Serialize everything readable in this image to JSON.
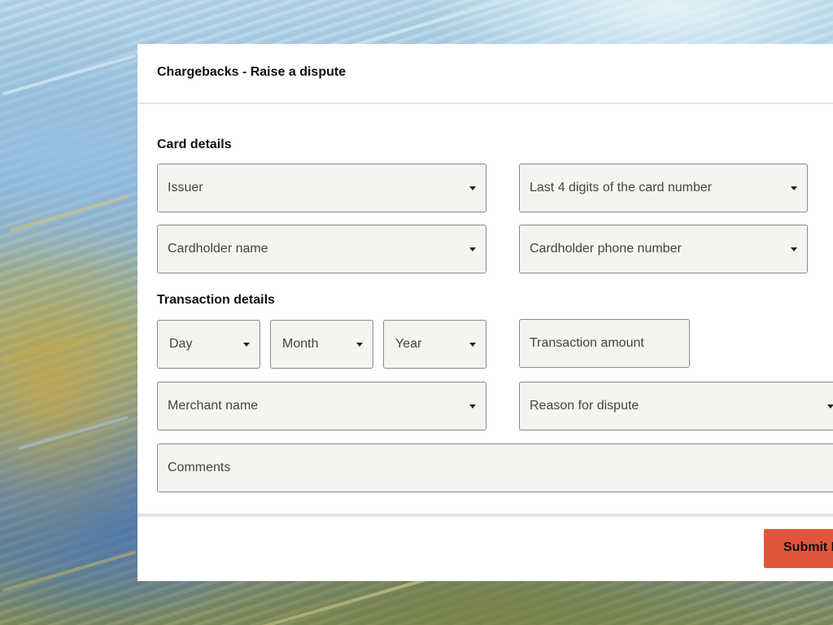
{
  "dialog": {
    "title": "Chargebacks - Raise a dispute",
    "submit_label": "Submit Dispute"
  },
  "card_details": {
    "heading": "Card details",
    "issuer": "Issuer",
    "last4": "Last 4 digits of the card number",
    "cardholder_name": "Cardholder name",
    "cardholder_phone": "Cardholder phone number"
  },
  "transaction_details": {
    "heading": "Transaction details",
    "day": "Day",
    "month": "Month",
    "year": "Year",
    "amount": "Transaction amount",
    "merchant_name": "Merchant name",
    "reason": "Reason for dispute",
    "comments": "Comments"
  },
  "icons": {
    "dropdown": "caret-down-icon"
  },
  "colors": {
    "accent": "#e3553a",
    "field_bg": "#f5f4f1",
    "field_border": "#8a8a8a"
  }
}
